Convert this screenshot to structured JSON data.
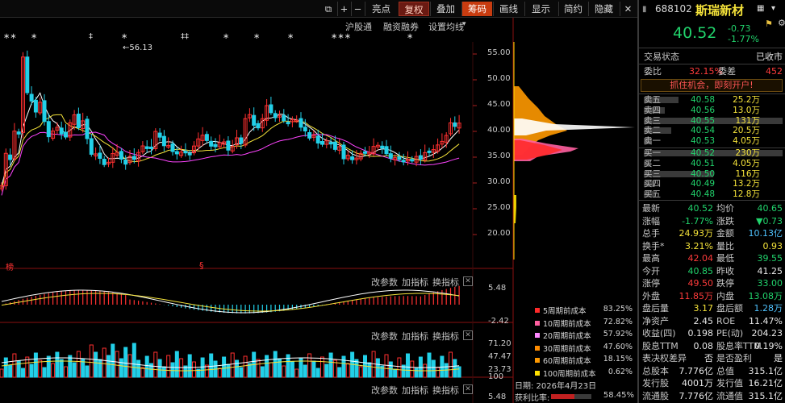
{
  "toolbar": {
    "items": [
      "亮点",
      "复权",
      "叠加",
      "筹码",
      "画线",
      "显示",
      "简约",
      "隐藏"
    ]
  },
  "chart_header": {
    "markers": [
      "∗∗",
      "∗",
      "‡",
      "∗",
      "‡‡",
      "∗",
      "∗",
      "∗",
      "∗∗∗",
      "∗"
    ],
    "links": [
      "沪股通",
      "融资融券",
      "设置均线"
    ]
  },
  "main_chart": {
    "peak_label": "56.13",
    "y_ticks": [
      "55.00",
      "50.00",
      "45.00",
      "40.00",
      "35.00",
      "30.00",
      "25.00",
      "20.00"
    ],
    "badge": "榜",
    "special_mark": "§"
  },
  "macd_panel": {
    "actions": [
      "改参数",
      "加指标",
      "换指标"
    ],
    "y_ticks": [
      "5.48",
      "-2.42"
    ]
  },
  "vol_panel": {
    "actions": [
      "改参数",
      "加指标",
      "换指标"
    ],
    "y_ticks": [
      "71.20",
      "47.47",
      "23.73",
      "100"
    ]
  },
  "bottom_panel": {
    "actions": [
      "改参数",
      "加指标",
      "换指标"
    ],
    "y_ticks": [
      "5.48"
    ]
  },
  "cost_legend": [
    {
      "name": "5周期前成本",
      "pct": "83.25%",
      "color": "#ff2a2a"
    },
    {
      "name": "10周期前成本",
      "pct": "72.82%",
      "color": "#ff5fa0"
    },
    {
      "name": "20周期前成本",
      "pct": "57.92%",
      "color": "#ff88ff"
    },
    {
      "name": "30周期前成本",
      "pct": "47.60%",
      "color": "#ff8c00"
    },
    {
      "name": "60周期前成本",
      "pct": "18.15%",
      "color": "#ff9900"
    },
    {
      "name": "100周期前成本",
      "pct": "0.62%",
      "color": "#ffe000"
    }
  ],
  "date_line": "日期: 2026年4月23日",
  "profit_line": {
    "label": "获利比率:",
    "value": "58.45%",
    "fraction": 0.5845
  },
  "stock": {
    "code": "688102",
    "name": "斯瑞新材",
    "price": "40.52",
    "change": "-0.73",
    "change_pct": "-1.77%"
  },
  "trade_status": {
    "label": "交易状态",
    "value": "已收市"
  },
  "order_ratio": {
    "label1": "委比",
    "value1": "32.15%",
    "label2": "委差",
    "value2": "452"
  },
  "banner": "抓住机会，即刻开户!",
  "asks": [
    {
      "label": "卖五",
      "price": "40.58",
      "vol": "25.2万",
      "bar": 0.25
    },
    {
      "label": "卖四",
      "price": "40.56",
      "vol": "13.0万",
      "bar": 0.15
    },
    {
      "label": "卖三",
      "price": "40.55",
      "vol": "131万",
      "bar": 1.0
    },
    {
      "label": "卖二",
      "price": "40.54",
      "vol": "20.5万",
      "bar": 0.2
    },
    {
      "label": "卖一",
      "price": "40.53",
      "vol": "4.05万",
      "bar": 0.06
    }
  ],
  "bids": [
    {
      "label": "买一",
      "price": "40.52",
      "vol": "230万",
      "bar": 1.0
    },
    {
      "label": "买二",
      "price": "40.51",
      "vol": "4.05万",
      "bar": 0.05
    },
    {
      "label": "买三",
      "price": "40.50",
      "vol": "116万",
      "bar": 0.5
    },
    {
      "label": "买四",
      "price": "40.49",
      "vol": "13.2万",
      "bar": 0.08
    },
    {
      "label": "买五",
      "price": "40.48",
      "vol": "12.8万",
      "bar": 0.08
    }
  ],
  "quotes": [
    {
      "k1": "最新",
      "v1": "40.52",
      "c1": "green",
      "k2": "均价",
      "v2": "40.65",
      "c2": "green"
    },
    {
      "k1": "涨幅",
      "v1": "-1.77%",
      "c1": "green",
      "k2": "涨跌",
      "v2": "▼0.73",
      "c2": "green"
    },
    {
      "k1": "总手",
      "v1": "24.93万",
      "c1": "yellow",
      "k2": "金额",
      "v2": "10.13亿",
      "c2": "cyan"
    },
    {
      "k1": "换手*",
      "v1": "3.21%",
      "c1": "yellow",
      "k2": "量比",
      "v2": "0.93",
      "c2": "yellow"
    },
    {
      "k1": "最高",
      "v1": "42.04",
      "c1": "red",
      "k2": "最低",
      "v2": "39.55",
      "c2": "green"
    },
    {
      "k1": "今开",
      "v1": "40.85",
      "c1": "green",
      "k2": "昨收",
      "v2": "41.25",
      "c2": "white"
    },
    {
      "k1": "涨停",
      "v1": "49.50",
      "c1": "red",
      "k2": "跌停",
      "v2": "33.00",
      "c2": "green"
    },
    {
      "k1": "外盘",
      "v1": "11.85万",
      "c1": "red",
      "k2": "内盘",
      "v2": "13.08万",
      "c2": "green"
    },
    {
      "k1": "盘后量",
      "v1": "3.17",
      "c1": "yellow",
      "k2": "盘后额",
      "v2": "1.28万",
      "c2": "cyan"
    },
    {
      "k1": "净资产",
      "v1": "2.45",
      "c1": "white",
      "k2": "ROE",
      "v2": "11.47%",
      "c2": "white"
    },
    {
      "k1": "收益(四)",
      "v1": "0.198",
      "c1": "white",
      "k2": "PE(动)",
      "v2": "204.23",
      "c2": "white"
    },
    {
      "k1": "股息TTM",
      "v1": "0.08",
      "c1": "white",
      "k2": "股息率TTM",
      "v2": "0.19%",
      "c2": "white"
    },
    {
      "k1": "表决权差异",
      "v1": "否",
      "c1": "white",
      "k2": "是否盈利",
      "v2": "是",
      "c2": "white"
    },
    {
      "k1": "总股本",
      "v1": "7.776亿",
      "c1": "white",
      "k2": "总值",
      "v2": "315.1亿",
      "c2": "white"
    },
    {
      "k1": "发行股",
      "v1": "4001万",
      "c1": "white",
      "k2": "发行值",
      "v2": "16.21亿",
      "c2": "white"
    },
    {
      "k1": "流通股",
      "v1": "7.776亿",
      "c1": "white",
      "k2": "流通值",
      "v2": "315.1亿",
      "c2": "white"
    }
  ]
}
